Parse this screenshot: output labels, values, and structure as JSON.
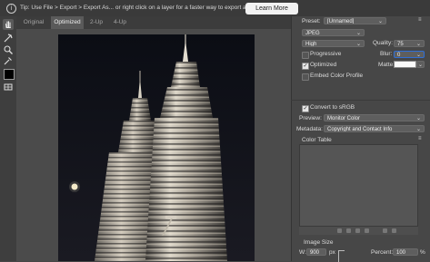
{
  "tipbar": {
    "icon": "info-icon",
    "icon_glyph": "i",
    "text": "Tip: Use File > Export > Export As... or right click on a layer for a faster way to export assets",
    "learn_more_label": "Learn More"
  },
  "tools": [
    "hand-icon",
    "slice-select-icon",
    "zoom-icon",
    "eyedropper-icon",
    "color-swatch",
    "toggle-slices-icon"
  ],
  "tabs": [
    {
      "label": "Original",
      "active": false
    },
    {
      "label": "Optimized",
      "active": true
    },
    {
      "label": "2-Up",
      "active": false
    },
    {
      "label": "4-Up",
      "active": false
    }
  ],
  "panel": {
    "preset_label": "Preset:",
    "preset_value": "[Unnamed]",
    "format_value": "JPEG",
    "quality_level_value": "High",
    "quality_label": "Quality:",
    "quality_value": "75",
    "progressive_label": "Progressive",
    "progressive_checked": false,
    "blur_label": "Blur:",
    "blur_value": "0",
    "optimized_label": "Optimized",
    "optimized_checked": true,
    "matte_label": "Matte:",
    "embed_profile_label": "Embed Color Profile",
    "embed_profile_checked": false,
    "convert_srgb_label": "Convert to sRGB",
    "convert_srgb_checked": true,
    "preview_label": "Preview:",
    "preview_value": "Monitor Color",
    "metadata_label": "Metadata:",
    "metadata_value": "Copyright and Contact Info",
    "color_table_label": "Color Table",
    "image_size_label": "Image Size",
    "width_label": "W:",
    "width_value": "900",
    "width_unit": "px",
    "percent_label": "Percent:",
    "percent_value": "100",
    "percent_unit": "%"
  },
  "colors": {
    "accent": "#2f6fd6",
    "panel_bg": "#474747",
    "tipbar_bg": "#3a3a3a"
  }
}
